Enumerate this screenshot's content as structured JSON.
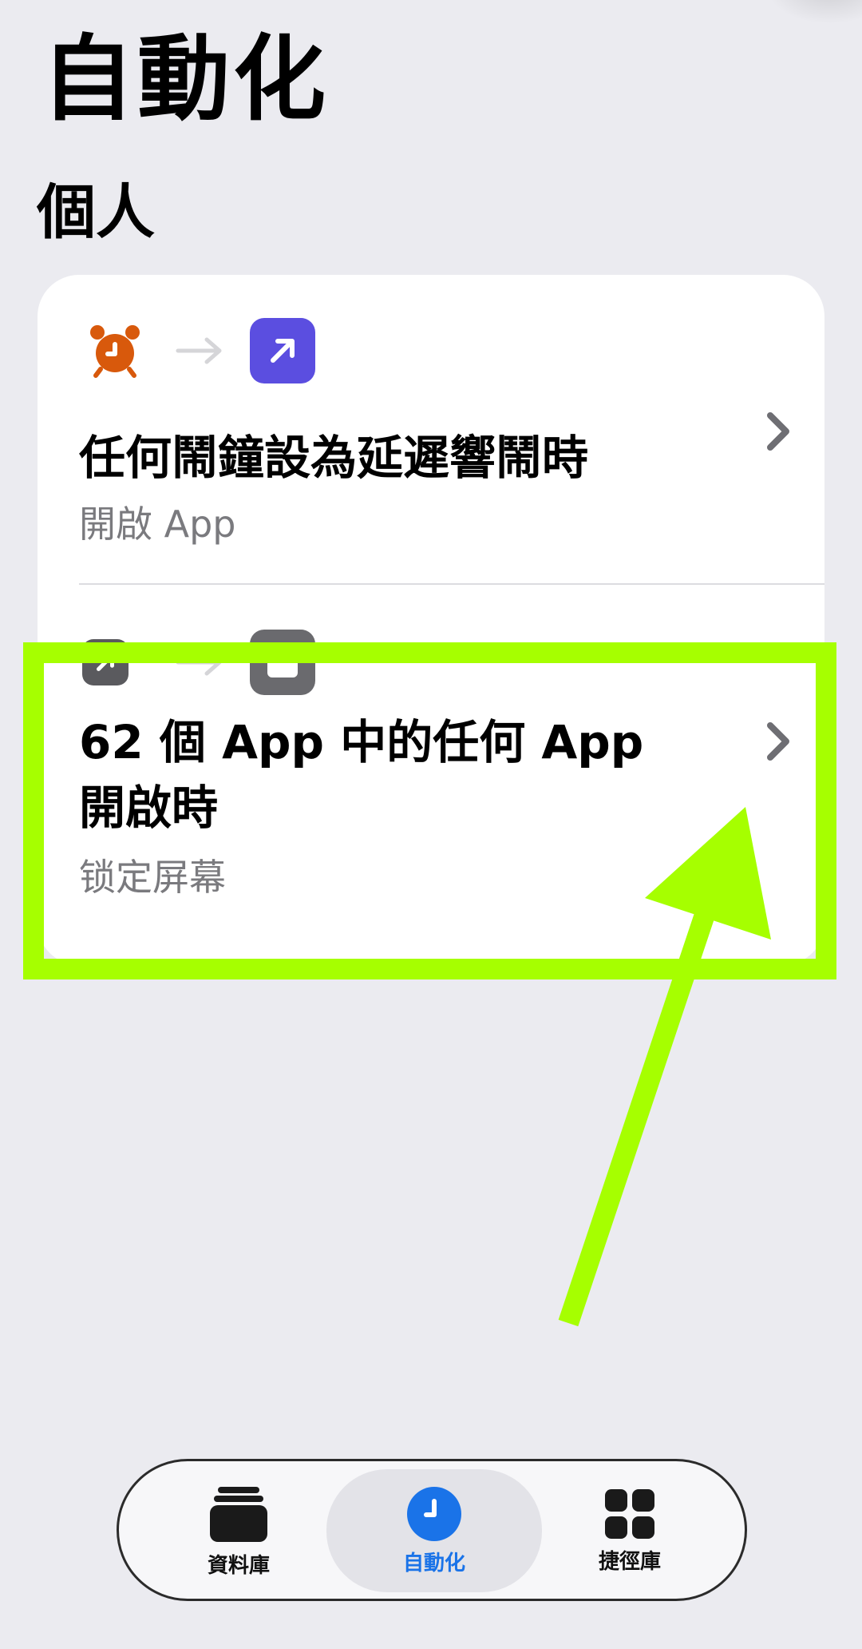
{
  "page": {
    "title": "自動化",
    "section_title": "個人"
  },
  "automations": [
    {
      "trigger_icon": "alarm-clock-icon",
      "action_icon": "open-app-icon",
      "title": "任何鬧鐘設為延遲響鬧時",
      "subtitle": "開啟 App"
    },
    {
      "trigger_icon": "open-app-icon",
      "action_icon": "lock-screen-icon",
      "title_line1": "62 個 App 中的任何 App",
      "title_line2": "開啟時",
      "subtitle": "锁定屏幕"
    }
  ],
  "tabbar": {
    "items": [
      {
        "label": "資料庫",
        "icon": "library-stack-icon",
        "active": false
      },
      {
        "label": "自動化",
        "icon": "clock-icon",
        "active": true
      },
      {
        "label": "捷徑庫",
        "icon": "grid-icon",
        "active": false
      }
    ]
  },
  "colors": {
    "highlight": "#a6ff00",
    "alarm_orange": "#d8590c",
    "open_app_purple": "#5b4ee0",
    "active_tab_blue": "#1a73e8"
  }
}
